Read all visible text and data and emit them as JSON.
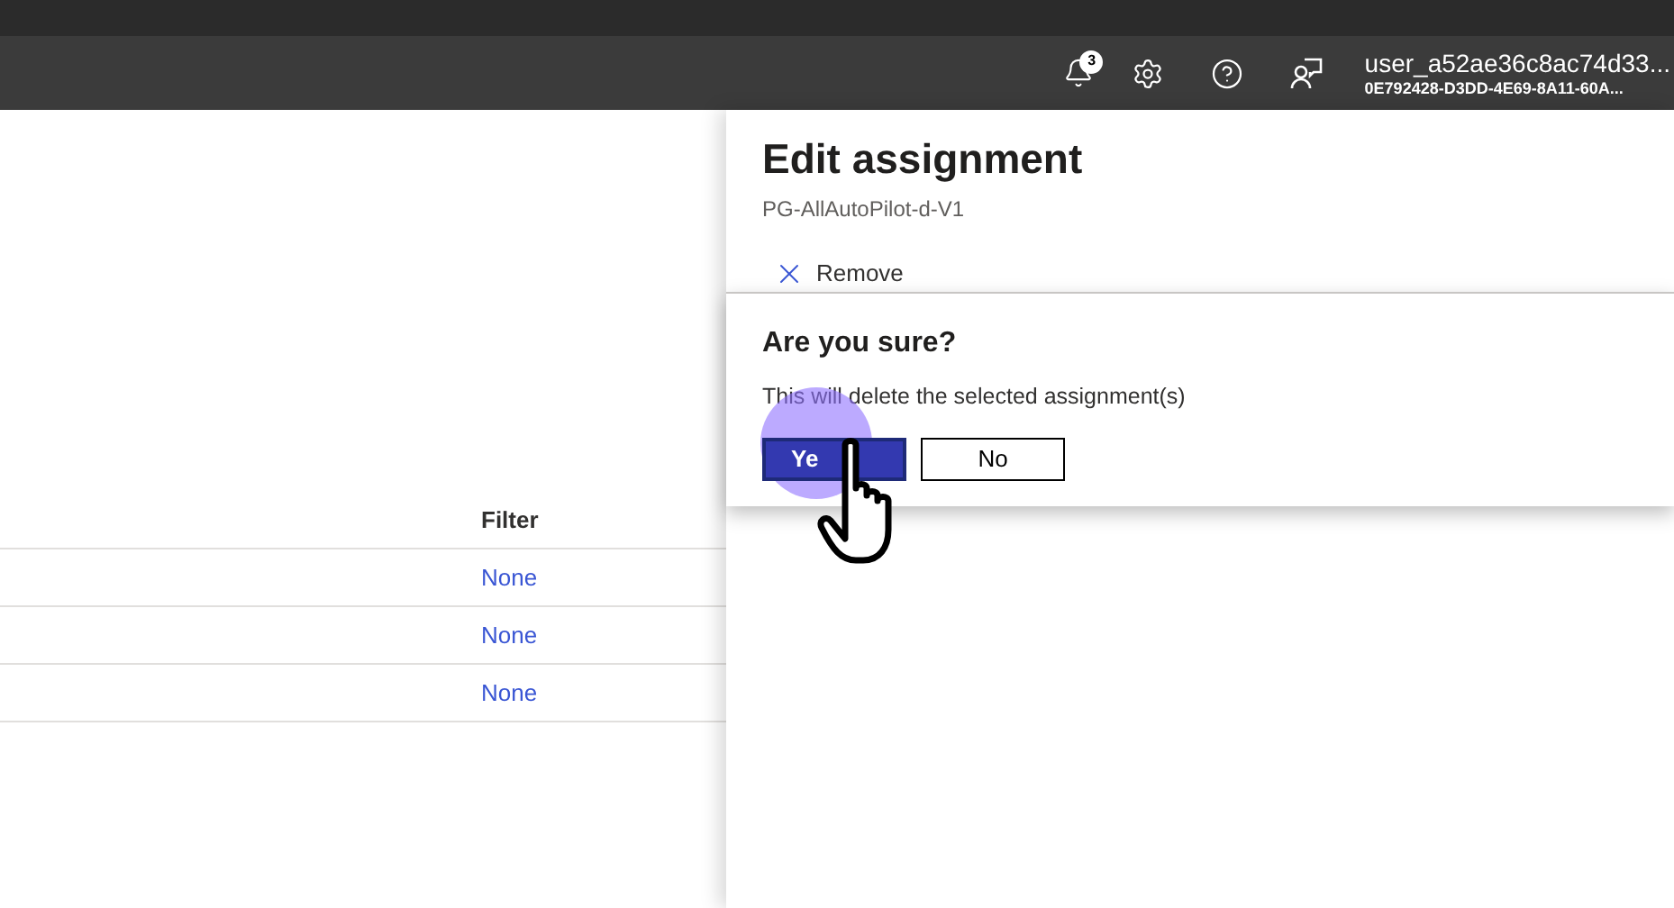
{
  "header": {
    "notifications_count": "3",
    "user_name": "user_a52ae36c8ac74d33...",
    "tenant_id": "0E792428-D3DD-4E69-8A11-60A..."
  },
  "table": {
    "columns": [
      "Filter"
    ],
    "rows": [
      {
        "filter": "None"
      },
      {
        "filter": "None"
      },
      {
        "filter": "None"
      }
    ]
  },
  "panel": {
    "title": "Edit assignment",
    "subtitle": "PG-AllAutoPilot-d-V1",
    "toolbar": [
      {
        "label": "Remove"
      }
    ]
  },
  "confirm": {
    "title": "Are you sure?",
    "message": "This will delete the selected assignment(s)",
    "buttons": [
      {
        "label": "Ye",
        "kind": "primary"
      },
      {
        "label": "No",
        "kind": "secondary"
      }
    ]
  }
}
